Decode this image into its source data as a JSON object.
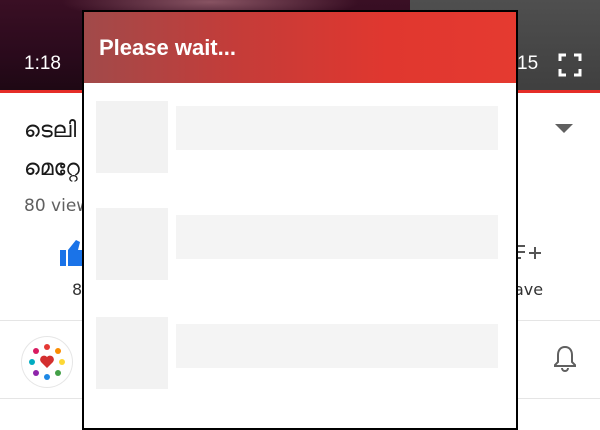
{
  "player": {
    "current_time": "1:18",
    "duration_partial": "15",
    "fullscreen_icon": "fullscreen-icon"
  },
  "video": {
    "title_line1": "ടെലി",
    "title_line2": "മെറ്റേ",
    "views": "80 view",
    "like_count": "8",
    "save_label": "ave"
  },
  "dialog": {
    "title": "Please wait...",
    "header_color": "#e53a30"
  },
  "colors": {
    "accent": "#e52d27",
    "like": "#1a73e8"
  }
}
